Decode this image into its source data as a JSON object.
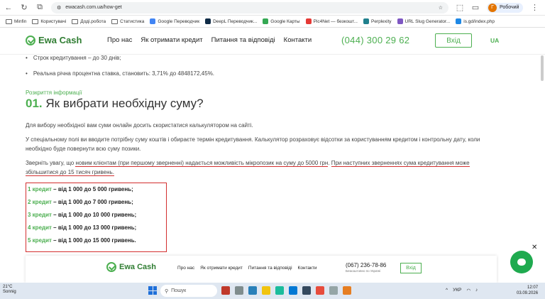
{
  "browser": {
    "url": "ewacash.com.ua/how-get",
    "profile_initial": "Г",
    "profile_label": "Робочий"
  },
  "bookmarks": [
    {
      "label": "Minfin",
      "kind": "folder"
    },
    {
      "label": "Користувачі",
      "kind": "folder"
    },
    {
      "label": "Доді.робота",
      "kind": "folder"
    },
    {
      "label": "Статистика",
      "kind": "folder"
    },
    {
      "label": "Google Переводчик",
      "kind": "site",
      "color": "#4285f4"
    },
    {
      "label": "DeepL Переводчик...",
      "kind": "site",
      "color": "#0f2b46"
    },
    {
      "label": "Google Карты",
      "kind": "site",
      "color": "#34a853"
    },
    {
      "label": "Pic4Net — безкошт...",
      "kind": "site",
      "color": "#e53935"
    },
    {
      "label": "Perplexity",
      "kind": "site",
      "color": "#20808d"
    },
    {
      "label": "URL Slug Generator...",
      "kind": "site",
      "color": "#7e57c2"
    },
    {
      "label": "is.gd/index.php",
      "kind": "site",
      "color": "#1e88e5"
    }
  ],
  "header": {
    "logo_text": "Ewa Cash",
    "nav": [
      "Про нас",
      "Як отримати кредит",
      "Питання та відповіді",
      "Контакти"
    ],
    "phone": "(044) 300 29 62",
    "login_label": "Вхід",
    "lang": "UA"
  },
  "content": {
    "bullets": [
      "Строк кредитування – до 30 днів;",
      "Реальна річна процентна ставка, становить: 3,71% до 4848172,45%."
    ],
    "section_label": "Розкриття інформації",
    "heading_num": "01.",
    "heading_text": "Як вибрати необхідну суму?",
    "para1": "Для вибору необхідної вам суми онлайн досить скористатися калькулятором на сайті.",
    "para2": "У спеціальному полі ви вводите потрібну суму коштів і обираєте термін кредитування. Калькулятор розраховує відсотки за користуванням кредитом і контрольну дату, коли необхідно буде повернути всю суму позики.",
    "para3_a": "Зверніть увагу, що ",
    "para3_b": "новим клієнтам (при першому зверненні) надається можливість мікропозик на суму до 5000 грн",
    "para3_c": ". ",
    "para3_d": "При наступних зверненнях сума кредитування може збільшитися до 15 тисяч гривень.",
    "limits": [
      {
        "credit": "1 кредит",
        "range": " – від 1 000 до 5 000 гривень;"
      },
      {
        "credit": "2 кредит",
        "range": " – від 1 000 до 7 000 гривень;"
      },
      {
        "credit": "3 кредит",
        "range": " – від 1 000 до 10 000 гривень;"
      },
      {
        "credit": "4 кредит",
        "range": " – від 1 000 до 13 000 гривень;"
      },
      {
        "credit": "5 кредит",
        "range": " – від 1 000 до 15 000 гривень."
      }
    ]
  },
  "sticky": {
    "logo_text": "Ewa Cash",
    "nav": [
      "Про нас",
      "Як отримати кредит",
      "Питання та відповіді",
      "Контакти"
    ],
    "phone": "(067) 236-78-86",
    "phone_sub": "Безкоштовно по Україні",
    "login_label": "Вхід"
  },
  "taskbar": {
    "weather_temp": "21°C",
    "weather_desc": "Sonnig",
    "search_placeholder": "Пошук",
    "lang": "УКР",
    "time": "12:07",
    "date": "03.09.2026"
  },
  "colors": {
    "brand_green": "#4caf50",
    "annotation_red": "#d32f2f"
  }
}
